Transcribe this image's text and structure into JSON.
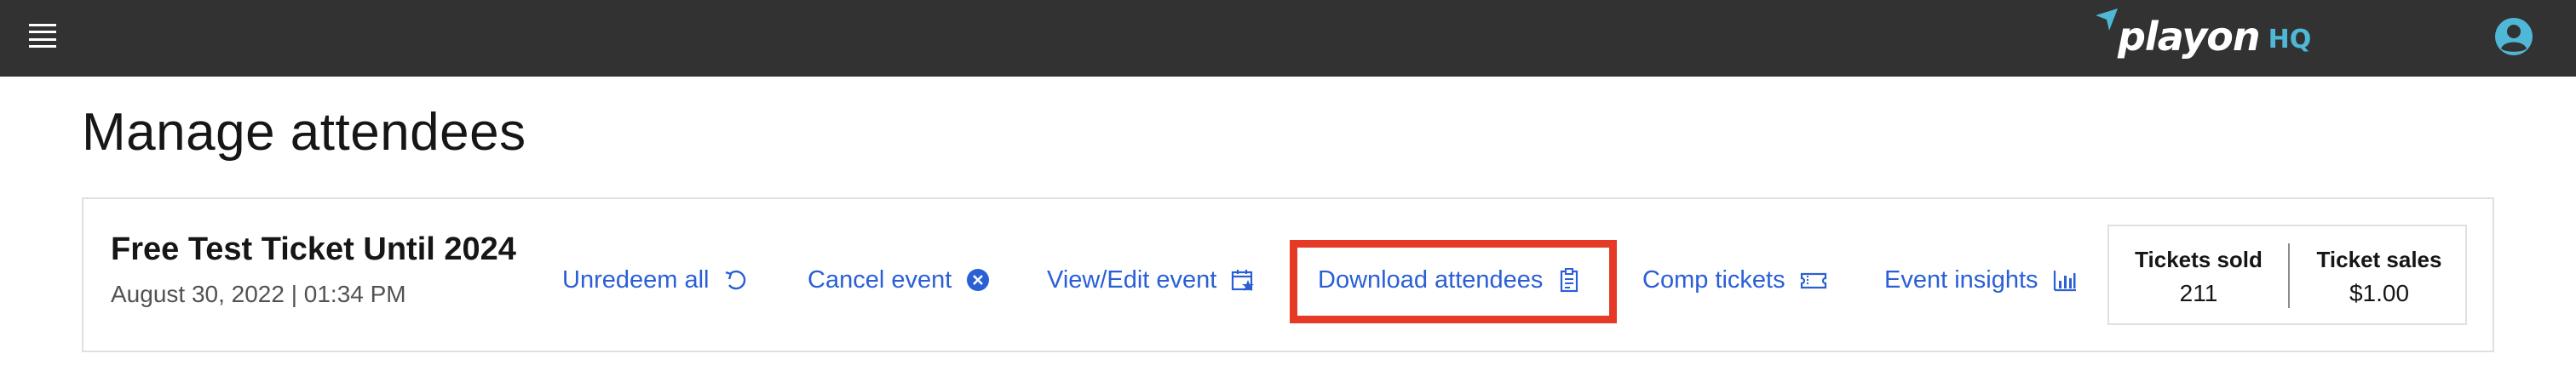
{
  "topbar": {
    "menu_icon": "hamburger-menu-icon",
    "logo_word": "playon",
    "logo_suffix": "HQ",
    "logo_accent_color": "#4fb8d6",
    "account_icon": "user-account-icon",
    "background": "#323232"
  },
  "page": {
    "title": "Manage attendees"
  },
  "event": {
    "name": "Free Test Ticket Until 2024",
    "date": "August 30, 2022 | 01:34 PM"
  },
  "actions": [
    {
      "label": "Unredeem all",
      "icon": "undo-icon"
    },
    {
      "label": "Cancel event",
      "icon": "close-circle-icon"
    },
    {
      "label": "View/Edit event",
      "icon": "calendar-star-icon"
    },
    {
      "label": "Download attendees",
      "icon": "clipboard-icon",
      "highlighted": true
    },
    {
      "label": "Comp tickets",
      "icon": "ticket-icon"
    },
    {
      "label": "Event insights",
      "icon": "bar-chart-icon"
    }
  ],
  "stats": {
    "tickets_sold_label": "Tickets sold",
    "tickets_sold_value": "211",
    "ticket_sales_label": "Ticket sales",
    "ticket_sales_value": "$1.00"
  },
  "colors": {
    "link": "#2a5fd6",
    "highlight": "#e53a26"
  }
}
